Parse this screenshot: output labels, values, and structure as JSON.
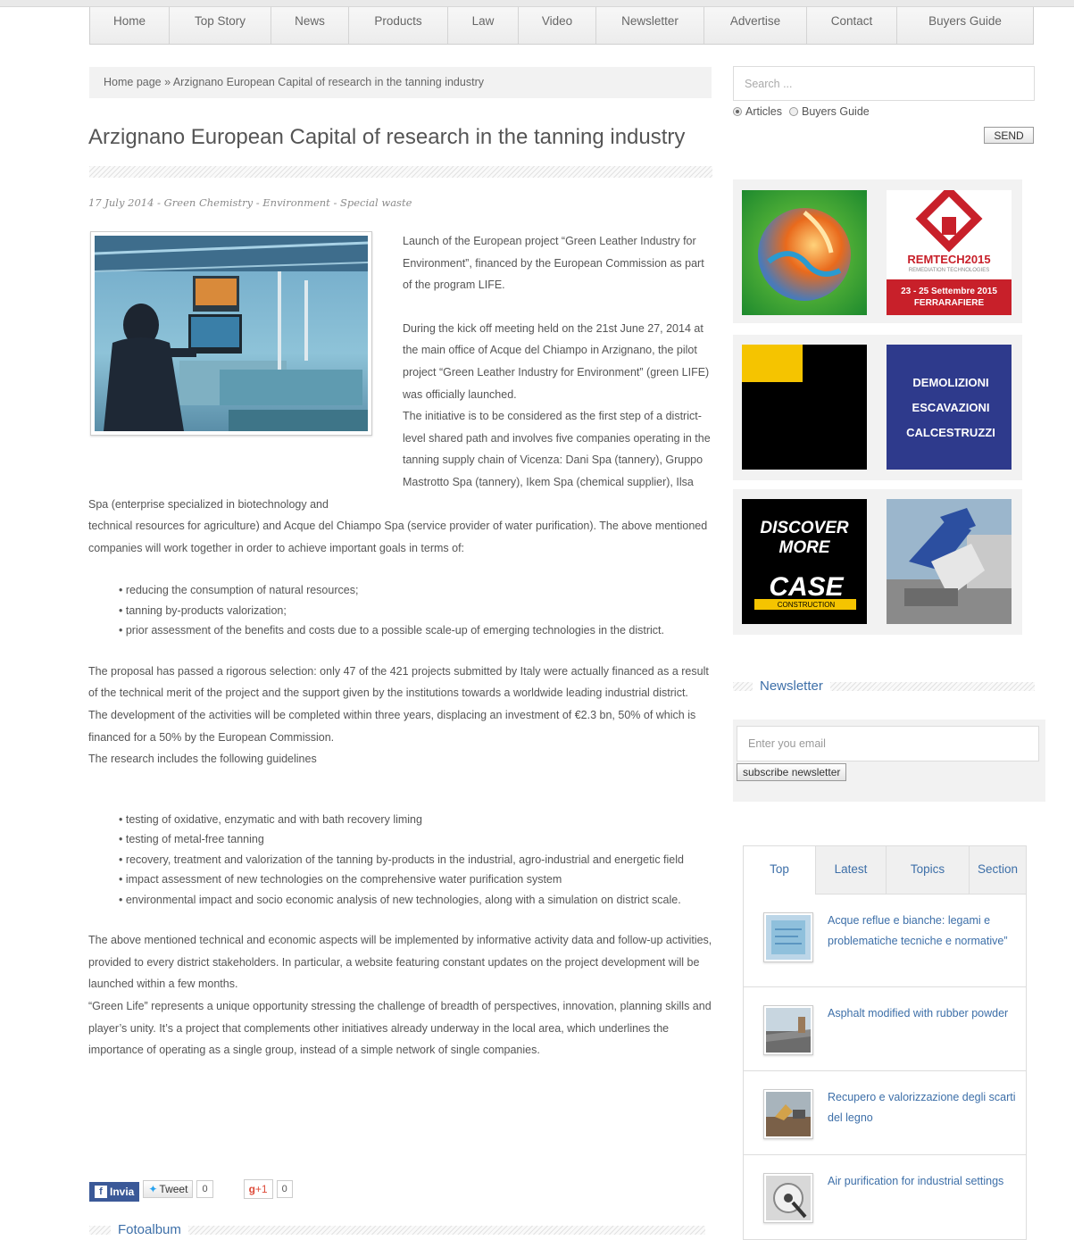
{
  "nav": {
    "items": [
      {
        "label": "Home"
      },
      {
        "label": "Top Story"
      },
      {
        "label": "News"
      },
      {
        "label": "Products"
      },
      {
        "label": "Law"
      },
      {
        "label": "Video"
      },
      {
        "label": "Newsletter"
      },
      {
        "label": "Advertise"
      },
      {
        "label": "Contact"
      },
      {
        "label": "Buyers Guide"
      }
    ]
  },
  "breadcrumb": {
    "home": "Home page",
    "separator": " » ",
    "current": "Arzignano European Capital of research in the tanning industry"
  },
  "article": {
    "title": "Arzignano European Capital of research in the tanning industry",
    "meta": "17 July 2014 - Green Chemistry - Environment - Special waste",
    "p1": "Launch of the European project “Green Leather Industry for Environment”, financed by the European Commission as part of the program LIFE.",
    "p2": "During the kick off meeting held on the 21st June 27, 2014 at the main office of Acque del Chiampo in Arzignano, the pilot project “Green Leather Industry for Environment” (green LIFE) was officially launched.",
    "p3": "The initiative is to be considered as the first step of a district-level shared path and involves five companies operating in the tanning supply chain of Vicenza: Dani Spa (tannery), Gruppo Mastrotto Spa (tannery), Ikem Spa (chemical supplier), Ilsa Spa (enterprise specialized in biotechnology and",
    "p4": "technical resources for agriculture) and Acque del Chiampo Spa (service provider of water purification). The above mentioned companies will work together in order to achieve important goals in terms of:",
    "goals": [
      "reducing the consumption of natural resources;",
      "tanning by-products valorization;",
      "prior assessment of the benefits and costs due to a possible scale-up of emerging technologies in the district."
    ],
    "p5": "The proposal has passed a rigorous selection: only 47 of the 421 projects submitted by Italy were actually financed as a result of the technical merit of the project and the support given by the institutions towards a worldwide leading industrial district.",
    "p6": "The development of the activities will be completed within three years, displacing an investment of €2.3 bn, 50% of which is financed for a 50% by the European Commission.",
    "p7": "The research includes the following guidelines",
    "guidelines": [
      "testing of oxidative, enzymatic and with bath recovery liming",
      "testing of metal-free tanning",
      "recovery, treatment and valorization of the tanning by-products in the industrial, agro-industrial and energetic field",
      "impact assessment of new technologies on the comprehensive water purification system",
      "environmental impact and socio economic analysis of new technologies, along with a simulation on district scale."
    ],
    "p8": "The above mentioned technical and economic aspects will be implemented by informative activity data and follow-up activities, provided to every district stakeholders. In particular, a website featuring constant updates on the project development will be launched within a few months.",
    "p9": "“Green Life” represents a unique opportunity stressing the challenge of breadth of perspectives, innovation, planning skills and player’s unity. It’s a project that complements other initiatives already underway in the local area, which underlines the importance of operating as a single group, instead of a simple network of single companies."
  },
  "social": {
    "fb_label": "Invia",
    "tweet_label": "Tweet",
    "tweet_count": "0",
    "gplus_label": "+1",
    "gplus_count": "0"
  },
  "fotoalbum": {
    "label": "Fotoalbum"
  },
  "search": {
    "placeholder": "Search ...",
    "option_articles": "Articles",
    "option_buyers": "Buyers Guide",
    "send_label": "SEND"
  },
  "ads": {
    "remtech_brand": "REMTECH2015",
    "remtech_sub": "REMEDIATION TECHNOLOGIES",
    "remtech_dates": "23 - 25 Settembre 2015",
    "remtech_venue": "FERRARAFIERE",
    "demolizioni_l1": "DEMOLIZIONI",
    "demolizioni_l2": "ESCAVAZIONI",
    "demolizioni_l3": "CALCESTRUZZI",
    "case_l1": "DISCOVER",
    "case_l2": "MORE",
    "case_brand": "CASE",
    "case_sub": "CONSTRUCTION"
  },
  "newsletter": {
    "heading": "Newsletter",
    "placeholder": "Enter you email",
    "button": "subscribe newsletter"
  },
  "tabs": {
    "items": [
      {
        "label": "Top"
      },
      {
        "label": "Latest"
      },
      {
        "label": "Topics"
      },
      {
        "label": "Section"
      }
    ]
  },
  "news": [
    {
      "title": "Acque reflue e bianche: legami e problematiche tecniche e normative”"
    },
    {
      "title": "Asphalt modified with rubber powder"
    },
    {
      "title": "Recupero e valorizzazione degli scarti del legno"
    },
    {
      "title": "Air purification for industrial settings"
    }
  ],
  "colors": {
    "link": "#3d6fa8",
    "text": "#555555",
    "facebook": "#3b5998",
    "remtech_red": "#c8202a",
    "demolizioni_blue": "#2e3a8c",
    "case_yellow": "#f5c400"
  }
}
